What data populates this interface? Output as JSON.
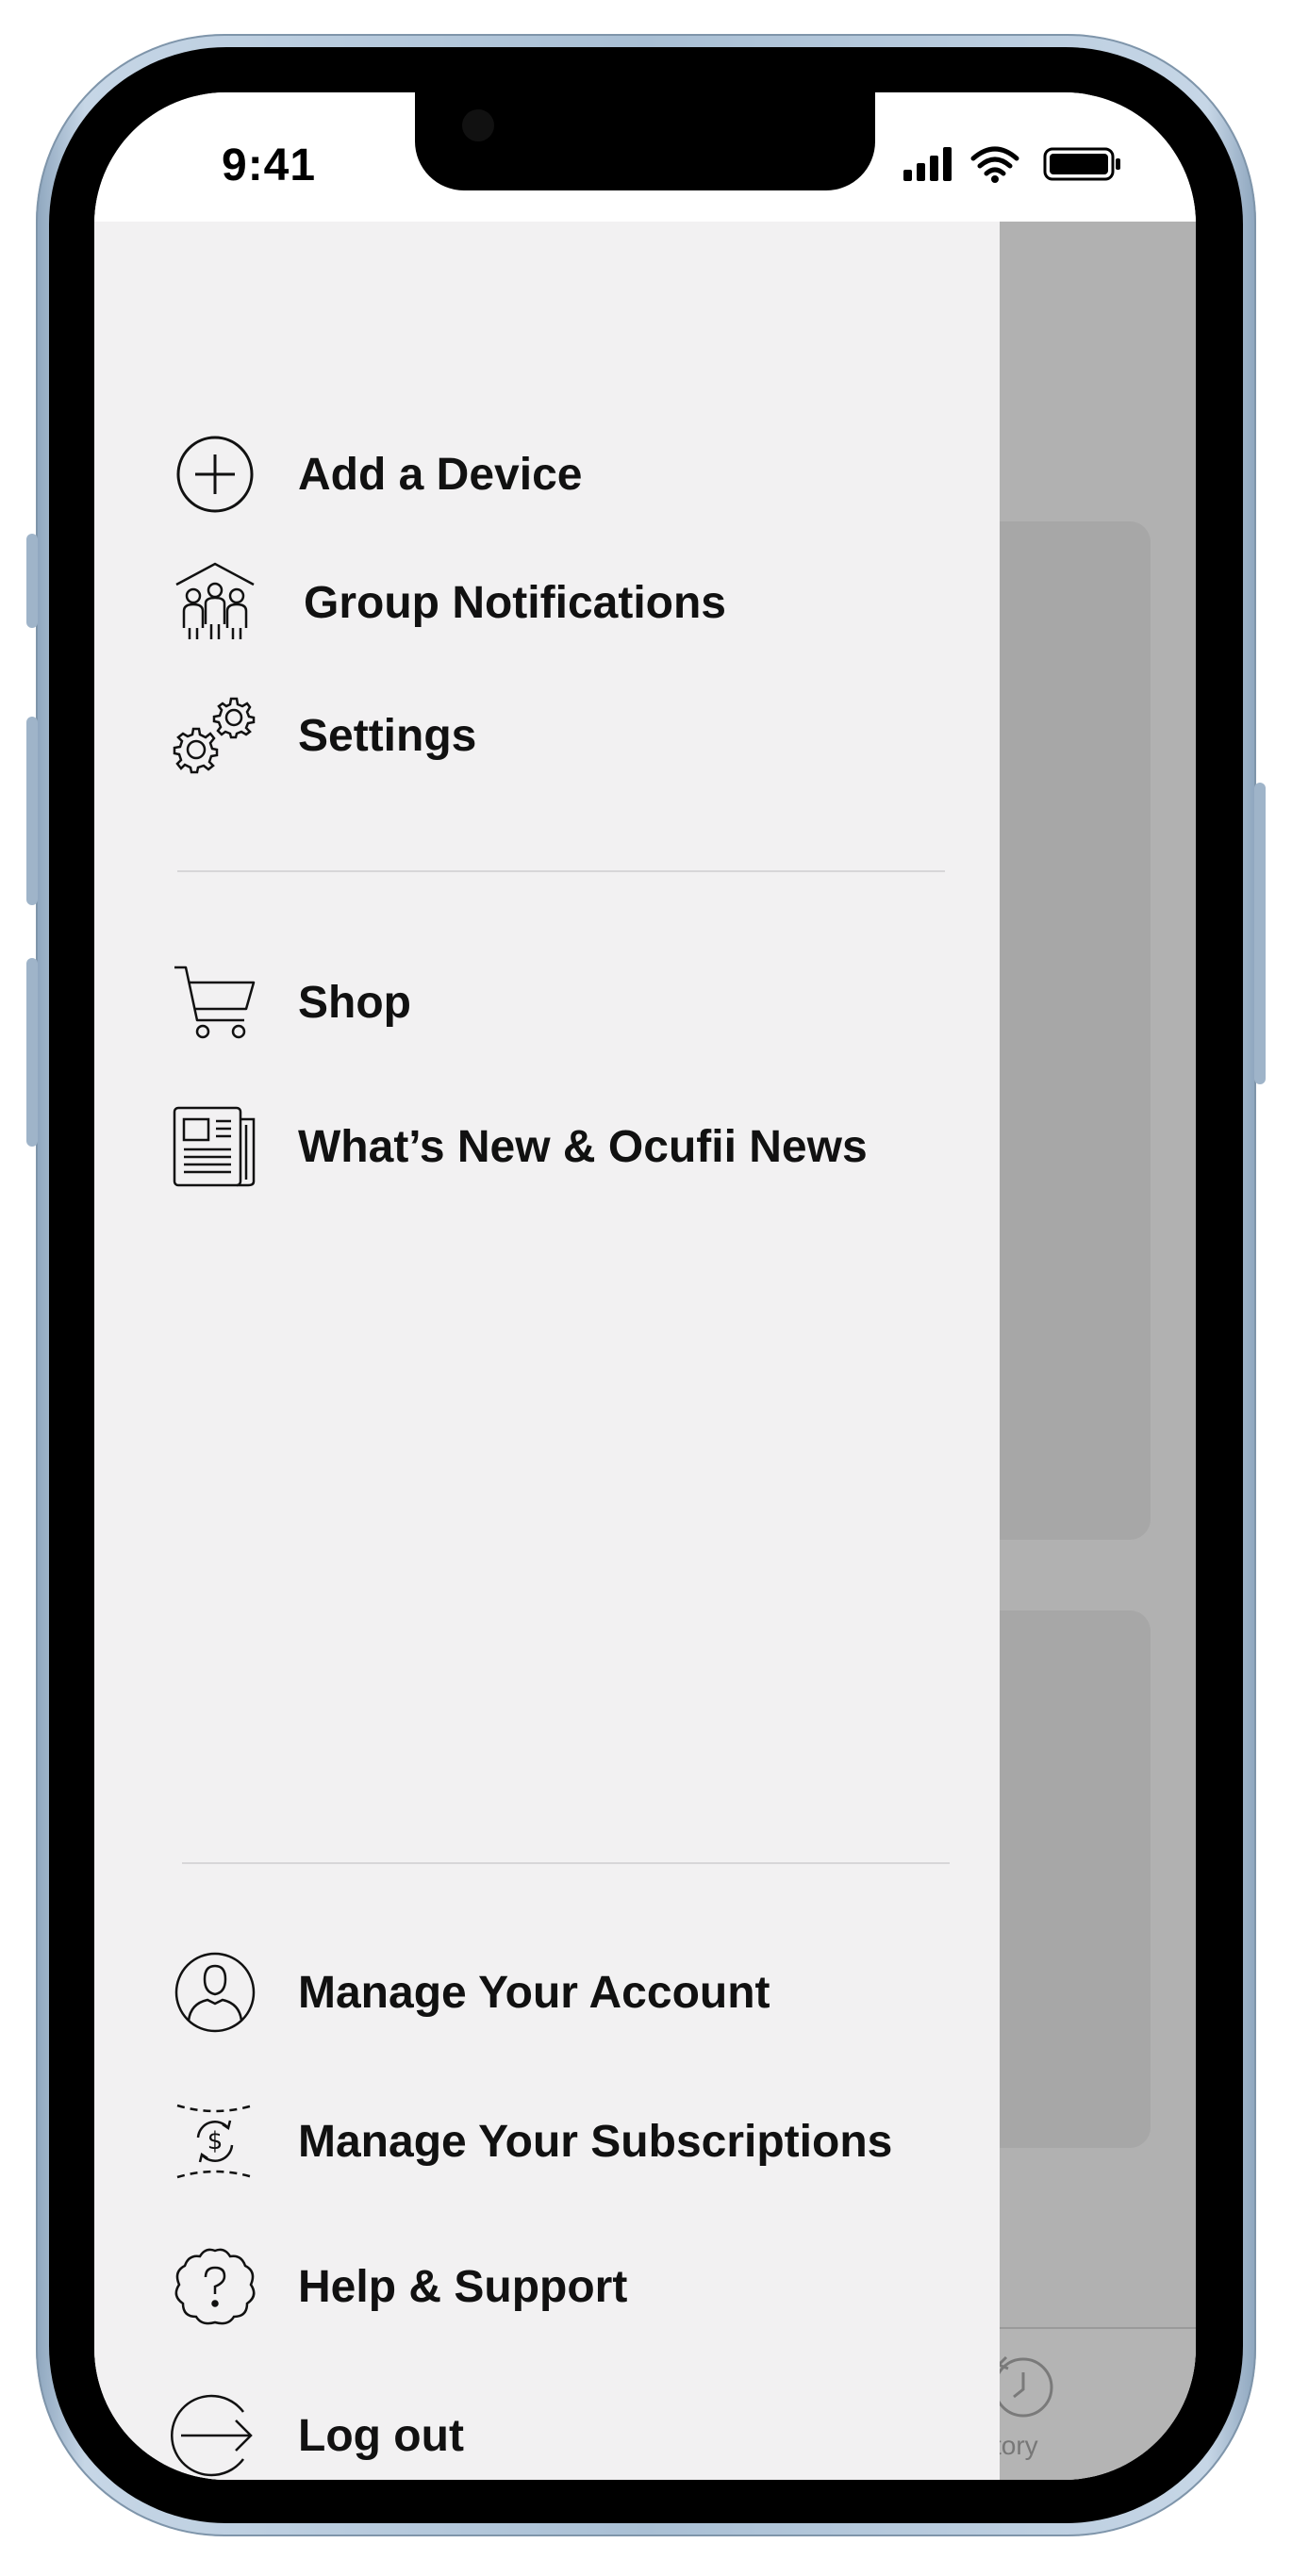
{
  "status_bar": {
    "time": "9:41"
  },
  "drawer": {
    "section1": [
      {
        "label": "Add a Device",
        "icon": "plus-circle-icon"
      },
      {
        "label": "Group Notifications",
        "icon": "group-home-icon"
      },
      {
        "label": "Settings",
        "icon": "gears-icon"
      }
    ],
    "section2": [
      {
        "label": "Shop",
        "icon": "cart-icon"
      },
      {
        "label": "What’s New & Ocufii News",
        "icon": "newspaper-icon"
      }
    ],
    "section3": [
      {
        "label": "Manage Your Account",
        "icon": "user-circle-icon"
      },
      {
        "label": "Manage Your Subscriptions",
        "icon": "subscription-dollar-icon"
      },
      {
        "label": "Help & Support",
        "icon": "help-cloud-icon"
      },
      {
        "label": "Log out",
        "icon": "logout-arrow-icon"
      }
    ]
  },
  "background": {
    "tab_label_partial": "story"
  },
  "colors": {
    "drawer_bg": "#f2f1f2",
    "overlay": "#b1b1b1",
    "frame": "#a9bfd4"
  }
}
